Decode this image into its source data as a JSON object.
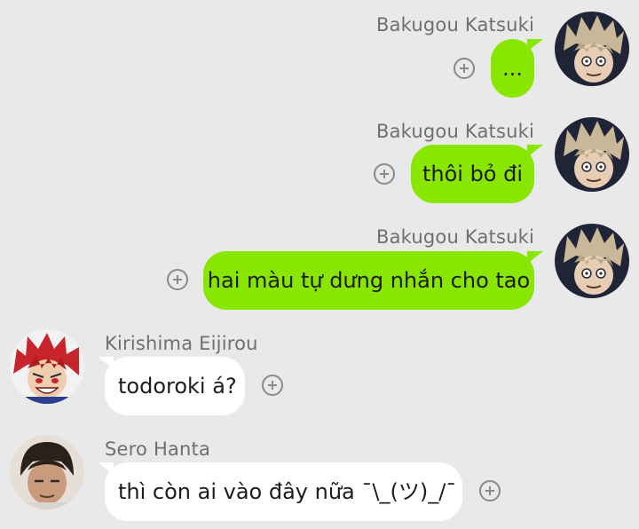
{
  "messages": [
    {
      "sender": "Bakugou Katsuki",
      "text": "...",
      "direction": "outgoing",
      "avatar": "spiky-blond-hair-avatar"
    },
    {
      "sender": "Bakugou Katsuki",
      "text": "thôi bỏ đi",
      "direction": "outgoing",
      "avatar": "spiky-blond-hair-avatar"
    },
    {
      "sender": "Bakugou Katsuki",
      "text": "hai màu tự dưng nhắn cho tao",
      "direction": "outgoing",
      "avatar": "spiky-blond-hair-avatar"
    },
    {
      "sender": "Kirishima Eijirou",
      "text": "todoroki á?",
      "direction": "incoming",
      "avatar": "red-spiky-hair-avatar"
    },
    {
      "sender": "Sero Hanta",
      "text": "thì còn ai vào đây nữa ¯\\_(ツ)_/¯",
      "direction": "incoming",
      "avatar": "black-hair-avatar"
    }
  ],
  "colors": {
    "background": "#e9e9e9",
    "outgoing_bubble": "#88e600",
    "incoming_bubble": "#ffffff",
    "sender_name": "#6f6f6f",
    "message_text": "#1c1c1c",
    "add_reaction_icon": "#8a8a8a"
  },
  "icons": {
    "add_reaction": "plus-circle-icon"
  }
}
